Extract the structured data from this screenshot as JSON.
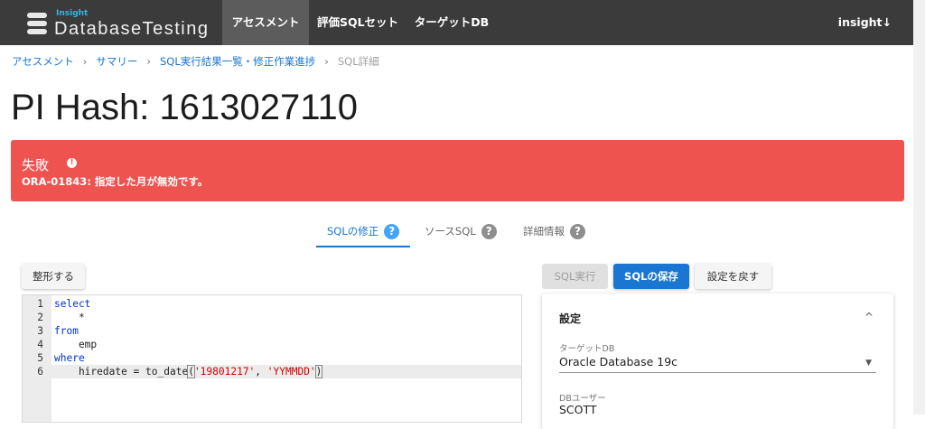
{
  "nav": {
    "logo_small": "Insight",
    "logo_text": "DatabaseTesting",
    "items": [
      "アセスメント",
      "評価SQLセット",
      "ターゲットDB"
    ],
    "user": "insight↓"
  },
  "breadcrumb": [
    "アセスメント",
    "サマリー",
    "SQL実行結果一覧・修正作業進捗",
    "SQL詳細"
  ],
  "title": "PI Hash: 1613027110",
  "alert": {
    "title": "失敗",
    "info_icon": "!",
    "message": "ORA-01843: 指定した月が無効です。"
  },
  "tabs": [
    {
      "label": "SQLの修正",
      "icon": "?"
    },
    {
      "label": "ソースSQL",
      "icon": "?"
    },
    {
      "label": "詳細情報",
      "icon": "?"
    }
  ],
  "buttons": {
    "format": "整形する",
    "run": "SQL実行",
    "save": "SQLの保存",
    "reset": "設定を戻す"
  },
  "editor": {
    "lines": [
      {
        "n": "1",
        "parts": [
          {
            "t": "select",
            "c": "kw"
          }
        ]
      },
      {
        "n": "2",
        "parts": [
          {
            "t": "    *",
            "c": ""
          }
        ]
      },
      {
        "n": "3",
        "parts": [
          {
            "t": "from",
            "c": "kw"
          }
        ]
      },
      {
        "n": "4",
        "parts": [
          {
            "t": "    emp",
            "c": ""
          }
        ]
      },
      {
        "n": "5",
        "parts": [
          {
            "t": "where",
            "c": "kw"
          }
        ]
      },
      {
        "n": "6",
        "parts": [
          {
            "t": "    hiredate = to_date",
            "c": ""
          },
          {
            "t": "(",
            "c": "bracket"
          },
          {
            "t": "'19801217'",
            "c": "str"
          },
          {
            "t": ", ",
            "c": ""
          },
          {
            "t": "'YYMMDD'",
            "c": "str"
          },
          {
            "t": ")",
            "c": "bracket"
          }
        ]
      }
    ]
  },
  "settings": {
    "title": "設定",
    "collapse_icon": "^",
    "target_db_label": "ターゲットDB",
    "target_db_value": "Oracle Database 19c",
    "dropdown_icon": "▼",
    "db_user_label": "DBユーザー",
    "db_user_value": "SCOTT"
  }
}
